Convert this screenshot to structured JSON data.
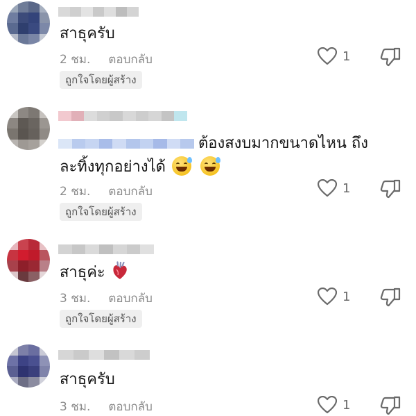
{
  "comments": [
    {
      "text": "สาธุครับ",
      "time": "2 ชม.",
      "reply_label": "ตอบกลับ",
      "badge": "ถูกใจโดยผู้สร้าง",
      "like_count": "1"
    },
    {
      "text_line1": "ต้องสงบมากขนาดไหน ถึง",
      "text_line2": "ละทิ้งทุกอย่างได้",
      "emojis": [
        "grinning-face-with-sweat",
        "grinning-face-with-sweat"
      ],
      "time": "2 ชม.",
      "reply_label": "ตอบกลับ",
      "badge": "ถูกใจโดยผู้สร้าง",
      "like_count": "1"
    },
    {
      "text": "สาธุค่ะ",
      "emojis": [
        "anatomical-heart"
      ],
      "time": "3 ชม.",
      "reply_label": "ตอบกลับ",
      "badge": "ถูกใจโดยผู้สร้าง",
      "like_count": "1"
    },
    {
      "text": "สาธุครับ",
      "time": "3 ชม.",
      "reply_label": "ตอบกลับ",
      "like_count": "1"
    }
  ],
  "icons": {
    "like": "heart-outline-icon",
    "dislike": "thumbs-down-outline-icon"
  },
  "colors": {
    "text_primary": "#161616",
    "text_secondary": "#8a8a8a",
    "badge_bg": "#efefef",
    "badge_text": "#555555",
    "icon_gray": "#6a6a6a"
  }
}
